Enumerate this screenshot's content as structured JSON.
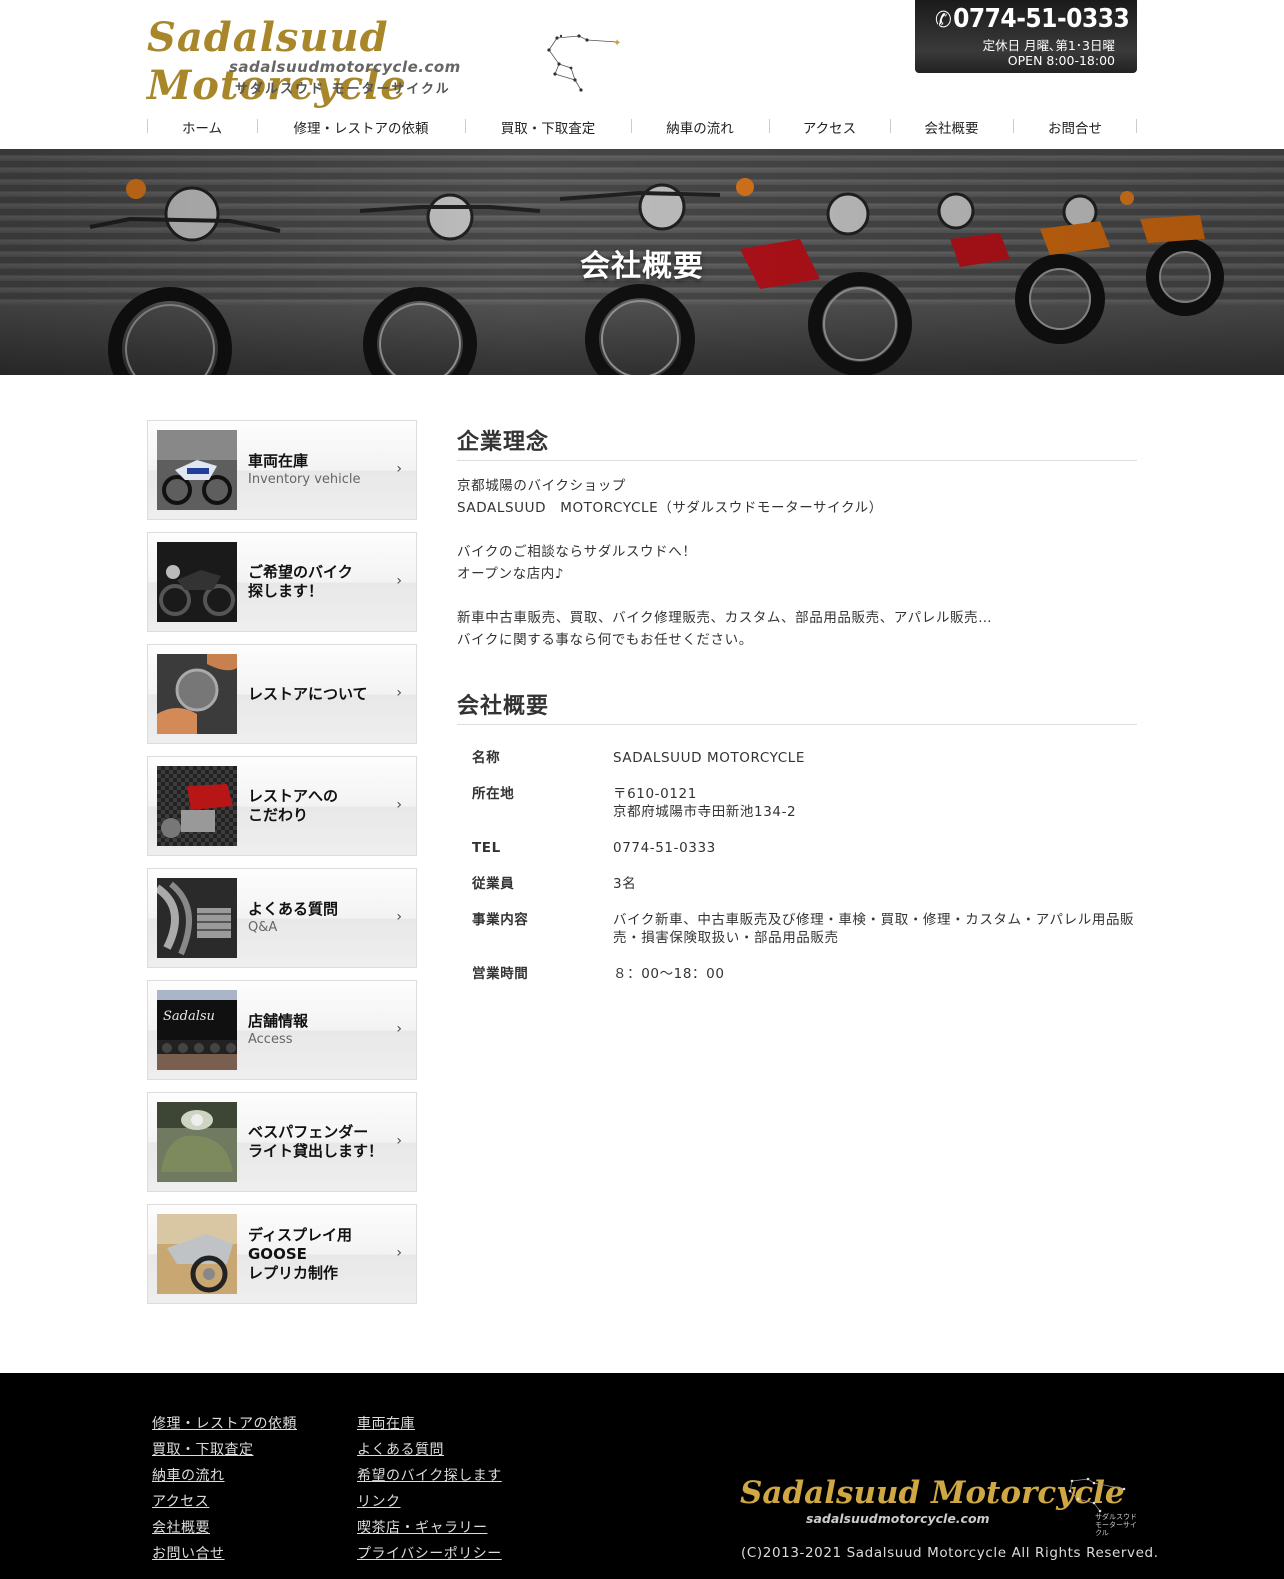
{
  "header": {
    "logo_main": "Sadalsuud Motorcycle",
    "logo_url": "sadalsuudmotorcycle.com",
    "logo_kana": "サダルスウド モーターサイクル",
    "phone": "0774-51-0333",
    "closed_days": "定休日 月曜､第1･3日曜",
    "hours": "OPEN 8:00-18:00"
  },
  "nav": [
    "ホーム",
    "修理・レストアの依頼",
    "買取・下取査定",
    "納車の流れ",
    "アクセス",
    "会社概要",
    "お問合せ"
  ],
  "hero": {
    "title": "会社概要"
  },
  "sidebar": [
    {
      "jp": "車両在庫",
      "en": "Inventory vehicle"
    },
    {
      "jp": "ご希望のバイク\n探します！",
      "en": ""
    },
    {
      "jp": "レストアについて",
      "en": ""
    },
    {
      "jp": "レストアへの\nこだわり",
      "en": ""
    },
    {
      "jp": "よくある質問",
      "en": "Q&A"
    },
    {
      "jp": "店舗情報",
      "en": "Access"
    },
    {
      "jp": "ベスパフェンダー\nライト貸出します！",
      "en": ""
    },
    {
      "jp": "ディスプレイ用\nGOOSE\nレプリカ制作",
      "en": ""
    }
  ],
  "philosophy": {
    "title": "企業理念",
    "lines": [
      "京都城陽のバイクショップ",
      "SADALSUUD　MOTORCYCLE（サダルスウドモーターサイクル）",
      "",
      "バイクのご相談ならサダルスウドへ！",
      "オープンな店内♪",
      "",
      "新車中古車販売、買取、バイク修理販売、カスタム、部品用品販売、アパレル販売…",
      "バイクに関する事なら何でもお任せください。"
    ]
  },
  "company": {
    "title": "会社概要",
    "rows": [
      {
        "k": "名称",
        "v": "SADALSUUD MOTORCYCLE"
      },
      {
        "k": "所在地",
        "v": "〒610-0121\n京都府城陽市寺田新池134-2"
      },
      {
        "k": "TEL",
        "v": "0774-51-0333"
      },
      {
        "k": "従業員",
        "v": "3名"
      },
      {
        "k": "事業内容",
        "v": "バイク新車、中古車販売及び修理・車検・買取・修理・カスタム・アパレル用品販売・損害保険取扱い・部品用品販売"
      },
      {
        "k": "営業時間",
        "v": "８：00～18：00"
      }
    ]
  },
  "footer": {
    "col1": [
      "修理・レストアの依頼",
      "買取・下取査定",
      "納車の流れ",
      "アクセス",
      "会社概要",
      "お問い合せ"
    ],
    "col2": [
      "車両在庫",
      "よくある質問",
      "希望のバイク探します",
      "リンク",
      "喫茶店・ギャラリー",
      "プライバシーポリシー"
    ],
    "logo_main": "Sadalsuud Motorcycle",
    "logo_url": "sadalsuudmotorcycle.com",
    "logo_kana": "サダルスウド\nモーターサイクル",
    "copyright": "(C)2013-2021 Sadalsuud Motorcycle All Rights Reserved."
  }
}
